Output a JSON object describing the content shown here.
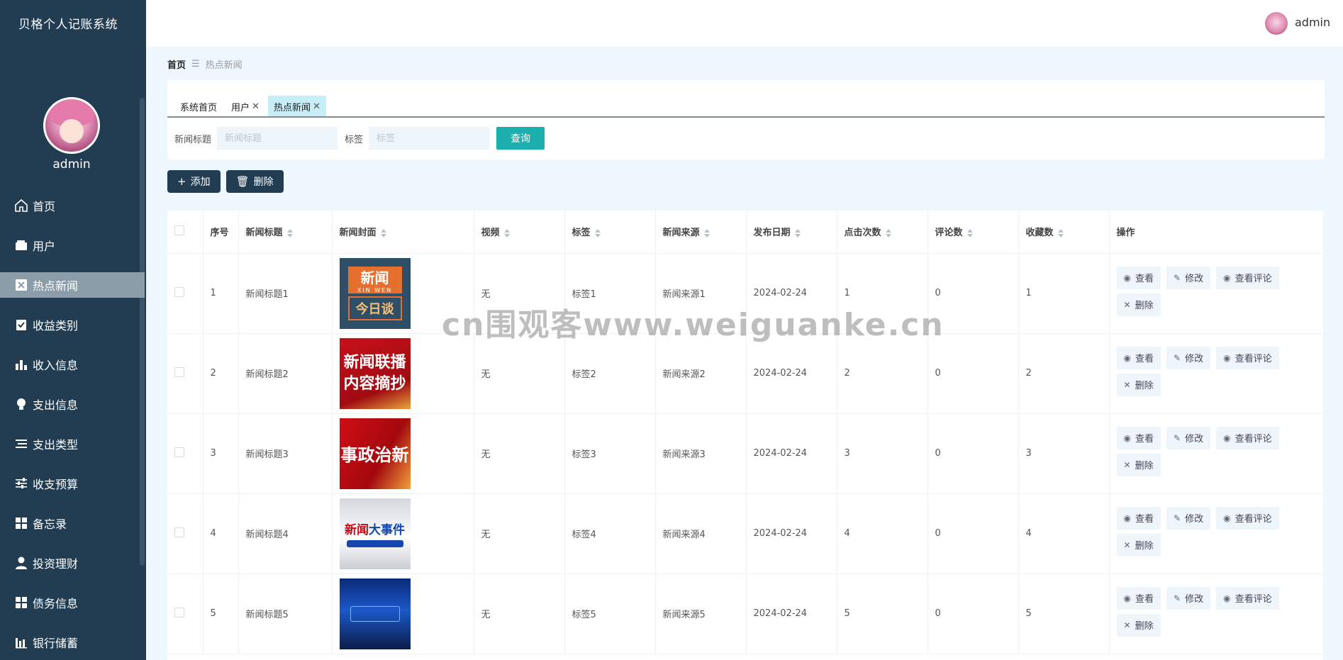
{
  "app": {
    "title": "贝格个人记账系统",
    "username": "admin"
  },
  "header": {
    "username": "admin"
  },
  "menu": [
    {
      "label": "首页",
      "icon": "home-icon",
      "active": false
    },
    {
      "label": "用户",
      "icon": "wallet-icon",
      "active": false
    },
    {
      "label": "热点新闻",
      "icon": "close-square-icon",
      "active": true
    },
    {
      "label": "收益类别",
      "icon": "clipboard-check-icon",
      "active": false
    },
    {
      "label": "收入信息",
      "icon": "bar-chart-icon",
      "active": false
    },
    {
      "label": "支出信息",
      "icon": "bulb-icon",
      "active": false
    },
    {
      "label": "支出类型",
      "icon": "list-icon",
      "active": false
    },
    {
      "label": "收支预算",
      "icon": "sliders-icon",
      "active": false
    },
    {
      "label": "备忘录",
      "icon": "grid-icon",
      "active": false
    },
    {
      "label": "投资理财",
      "icon": "user-icon",
      "active": false
    },
    {
      "label": "债务信息",
      "icon": "grid-icon",
      "active": false
    },
    {
      "label": "银行储蓄",
      "icon": "bar-chart-icon",
      "active": false
    }
  ],
  "breadcrumb": {
    "home": "首页",
    "current": "热点新闻"
  },
  "tabs": [
    {
      "label": "系统首页",
      "closable": false,
      "active": false
    },
    {
      "label": "用户",
      "closable": true,
      "active": false
    },
    {
      "label": "热点新闻",
      "closable": true,
      "active": true
    }
  ],
  "filter": {
    "title_label": "新闻标题",
    "title_placeholder": "新闻标题",
    "tag_label": "标签",
    "tag_placeholder": "标签",
    "query_button": "查询"
  },
  "toolbar": {
    "add_label": "添加",
    "delete_label": "删除"
  },
  "table": {
    "columns": [
      "序号",
      "新闻标题",
      "新闻封面",
      "视频",
      "标签",
      "新闻来源",
      "发布日期",
      "点击次数",
      "评论数",
      "收藏数",
      "操作"
    ],
    "rows": [
      {
        "index": "1",
        "title": "新闻标题1",
        "cover_text": [
          "新闻",
          "XIN WEN",
          "今日谈"
        ],
        "video": "无",
        "tag": "标签1",
        "source": "新闻来源1",
        "date": "2024-02-24",
        "clicks": "1",
        "comments": "0",
        "favorites": "1"
      },
      {
        "index": "2",
        "title": "新闻标题2",
        "cover_text": [
          "新闻联播",
          "内容摘抄"
        ],
        "video": "无",
        "tag": "标签2",
        "source": "新闻来源2",
        "date": "2024-02-24",
        "clicks": "2",
        "comments": "0",
        "favorites": "2"
      },
      {
        "index": "3",
        "title": "新闻标题3",
        "cover_text": [
          "事政治新"
        ],
        "video": "无",
        "tag": "标签3",
        "source": "新闻来源3",
        "date": "2024-02-24",
        "clicks": "3",
        "comments": "0",
        "favorites": "3"
      },
      {
        "index": "4",
        "title": "新闻标题4",
        "cover_text": [
          "新闻",
          "大事件"
        ],
        "video": "无",
        "tag": "标签4",
        "source": "新闻来源4",
        "date": "2024-02-24",
        "clicks": "4",
        "comments": "0",
        "favorites": "4"
      },
      {
        "index": "5",
        "title": "新闻标题5",
        "cover_text": [],
        "video": "无",
        "tag": "标签5",
        "source": "新闻来源5",
        "date": "2024-02-24",
        "clicks": "5",
        "comments": "0",
        "favorites": "5"
      }
    ],
    "op_labels": {
      "view": "查看",
      "edit": "修改",
      "view_comments": "查看评论",
      "delete": "删除"
    }
  },
  "watermark": "cn围观客www.weiguanke.cn",
  "colors": {
    "sidebar": "#223c52",
    "accent": "#1bb0ad",
    "active_tab": "#c7eef6"
  }
}
